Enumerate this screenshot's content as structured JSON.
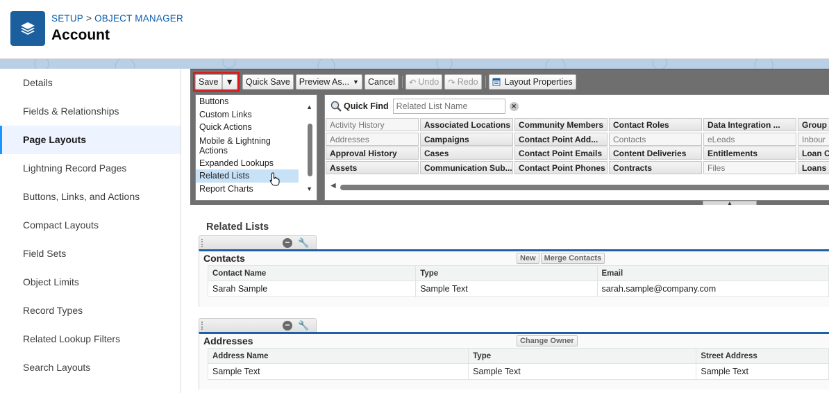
{
  "header": {
    "breadcrumb_setup": "SETUP",
    "breadcrumb_separator": ">",
    "breadcrumb_object_manager": "OBJECT MANAGER",
    "title": "Account",
    "icon": "layers-icon"
  },
  "sidebar": {
    "items": [
      {
        "label": "Details"
      },
      {
        "label": "Fields & Relationships"
      },
      {
        "label": "Page Layouts",
        "selected": true
      },
      {
        "label": "Lightning Record Pages"
      },
      {
        "label": "Buttons, Links, and Actions"
      },
      {
        "label": "Compact Layouts"
      },
      {
        "label": "Field Sets"
      },
      {
        "label": "Object Limits"
      },
      {
        "label": "Record Types"
      },
      {
        "label": "Related Lookup Filters"
      },
      {
        "label": "Search Layouts"
      }
    ]
  },
  "toolbar": {
    "save": "Save",
    "quick_save": "Quick Save",
    "preview_as": "Preview As...",
    "cancel": "Cancel",
    "undo": "Undo",
    "redo": "Redo",
    "layout_properties": "Layout Properties"
  },
  "palette": {
    "categories": [
      {
        "label": "Buttons"
      },
      {
        "label": "Custom Links"
      },
      {
        "label": "Quick Actions"
      },
      {
        "label": "Mobile & Lightning Actions"
      },
      {
        "label": "Expanded Lookups"
      },
      {
        "label": "Related Lists",
        "selected": true
      },
      {
        "label": "Report Charts"
      }
    ],
    "quick_find_label": "Quick Find",
    "quick_find_placeholder": "Related List Name",
    "grid": [
      [
        "Activity History",
        "Associated Locations",
        "Community Members",
        "Contact Roles",
        "Data Integration ...",
        "Group"
      ],
      [
        "Addresses",
        "Campaigns",
        "Contact Point Add...",
        "Contacts",
        "eLeads",
        "Inbour"
      ],
      [
        "Approval History",
        "Cases",
        "Contact Point Emails",
        "Content Deliveries",
        "Entitlements",
        "Loan C"
      ],
      [
        "Assets",
        "Communication Sub...",
        "Contact Point Phones",
        "Contracts",
        "Files",
        "Loans"
      ]
    ],
    "used": [
      "Activity History",
      "Addresses",
      "Contacts",
      "eLeads",
      "Files",
      "Inbour"
    ]
  },
  "layout": {
    "section_title": "Related Lists",
    "related_lists": [
      {
        "name": "Contacts",
        "buttons": [
          "New",
          "Merge Contacts"
        ],
        "columns": [
          "Contact Name",
          "Type",
          "Email"
        ],
        "row": [
          "Sarah Sample",
          "Sample Text",
          "sarah.sample@company.com"
        ]
      },
      {
        "name": "Addresses",
        "buttons": [
          "Change Owner"
        ],
        "columns": [
          "Address Name",
          "Type",
          "Street Address"
        ],
        "row": [
          "Sample Text",
          "Sample Text",
          "Sample Text"
        ]
      }
    ]
  }
}
